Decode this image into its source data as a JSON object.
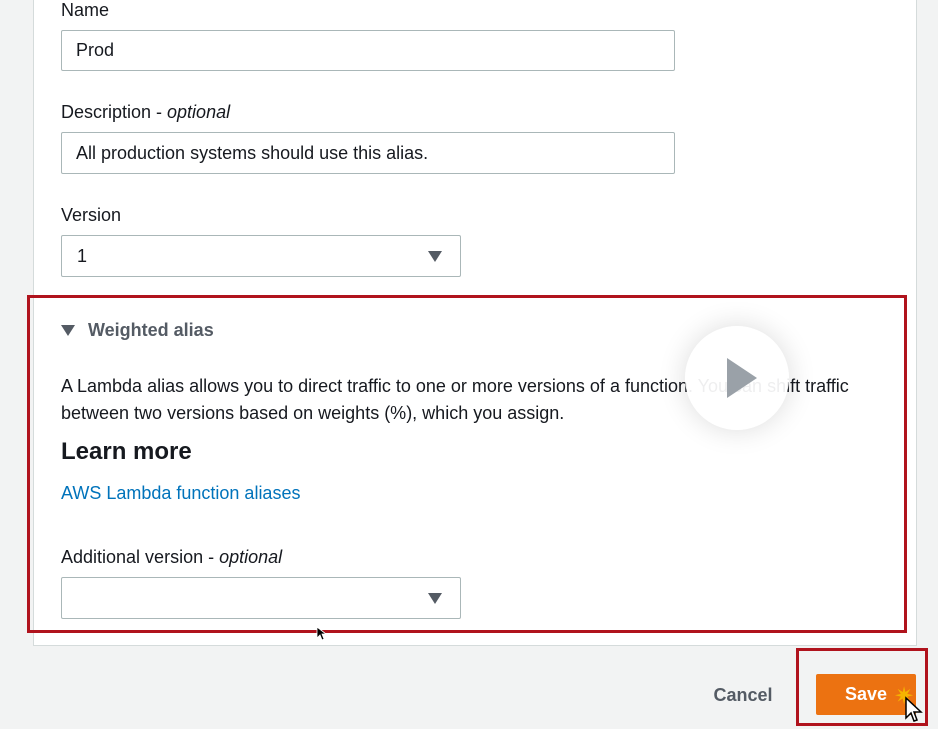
{
  "form": {
    "name_label": "Name",
    "name_value": "Prod",
    "description_label": "Description - ",
    "description_optional": "optional",
    "description_value": "All production systems should use this alias.",
    "version_label": "Version",
    "version_value": "1"
  },
  "weighted_alias": {
    "title": "Weighted alias",
    "description": "A Lambda alias allows you to direct traffic to one or more versions of a function. You can shift traffic between two versions based on weights (%), which you assign.",
    "learn_more_heading": "Learn more",
    "link_text": "AWS Lambda function aliases",
    "additional_version_label": "Additional version - ",
    "additional_version_optional": "optional",
    "additional_version_value": ""
  },
  "actions": {
    "cancel_label": "Cancel",
    "save_label": "Save"
  },
  "colors": {
    "highlight": "#b0131d",
    "save_button": "#ec7211",
    "link": "#0073bb"
  },
  "icons": [
    "caret-down-icon",
    "play-icon",
    "expand-triangle-icon",
    "cursor-icon",
    "click-sparkle-icon"
  ]
}
